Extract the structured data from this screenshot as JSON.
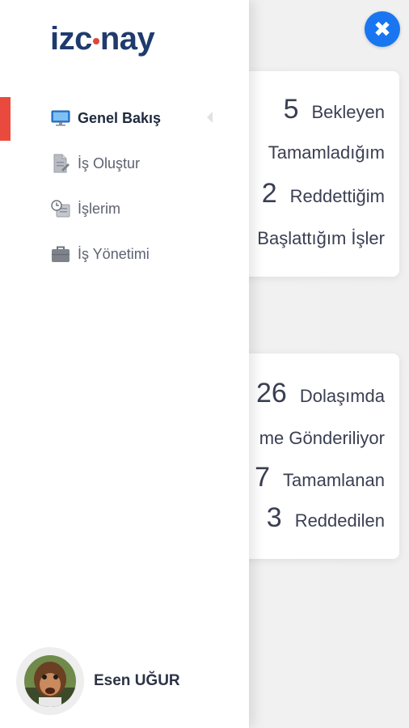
{
  "brand": {
    "logo_left": "izc",
    "logo_right": "nay"
  },
  "dashboard": {
    "card1": {
      "rows": [
        {
          "num": "5",
          "label": "Bekleyen"
        },
        {
          "num": "",
          "label": "Tamamladığım"
        },
        {
          "num": "2",
          "label": "Reddettiğim"
        },
        {
          "num": "",
          "label": "Başlattığım İşler"
        }
      ]
    },
    "card2": {
      "rows": [
        {
          "num": "26",
          "label": "Dolaşımda"
        },
        {
          "num": "",
          "label": "me Gönderiliyor"
        },
        {
          "num": "7",
          "label": "Tamamlanan"
        },
        {
          "num": "3",
          "label": "Reddedilen"
        }
      ]
    }
  },
  "close_button": {
    "glyph": "✖"
  },
  "menu": {
    "items": [
      {
        "label": "Genel Bakış",
        "icon": "monitor-icon",
        "active": true
      },
      {
        "label": "İş Oluştur",
        "icon": "document-edit-icon",
        "active": false
      },
      {
        "label": "İşlerim",
        "icon": "clock-list-icon",
        "active": false
      },
      {
        "label": "İş Yönetimi",
        "icon": "briefcase-icon",
        "active": false
      }
    ]
  },
  "user": {
    "name": "Esen UĞUR",
    "avatar": "user-avatar"
  },
  "colors": {
    "accent": "#e94a3d",
    "brand": "#1f3b6e",
    "close": "#1976f0"
  }
}
